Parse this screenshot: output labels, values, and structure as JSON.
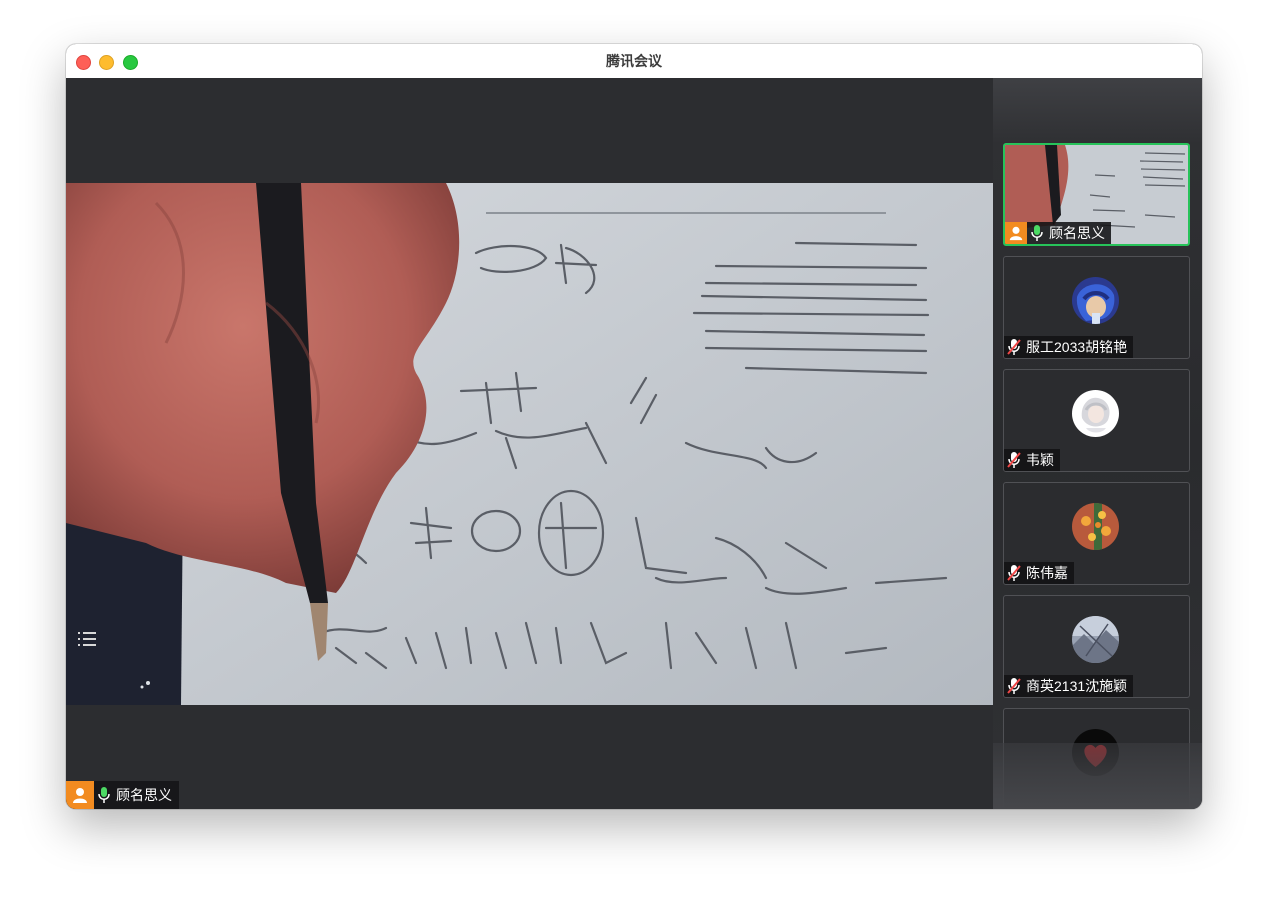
{
  "window": {
    "title": "腾讯会议"
  },
  "main_view": {
    "speaker_name": "顾名思义",
    "mic_state": "on"
  },
  "participants": [
    {
      "name": "顾名思义",
      "mic_state": "on",
      "active": true,
      "avatar": "video-thumbnail"
    },
    {
      "name": "服工2033胡铭艳",
      "mic_state": "muted",
      "active": false,
      "avatar": "blue-hair-anime"
    },
    {
      "name": "韦颖",
      "mic_state": "muted",
      "active": false,
      "avatar": "white-character"
    },
    {
      "name": "陈伟嘉",
      "mic_state": "muted",
      "active": false,
      "avatar": "orange-floral"
    },
    {
      "name": "商英2131沈施颖",
      "mic_state": "muted",
      "active": false,
      "avatar": "gray-landscape"
    },
    {
      "name": "",
      "mic_state": "muted",
      "active": false,
      "avatar": "red-heart-dark"
    }
  ],
  "colors": {
    "active_border": "#27c35a",
    "mic_on": "#4cd964",
    "mic_muted": "#f04747",
    "avatar_orange": "#f28b20"
  }
}
